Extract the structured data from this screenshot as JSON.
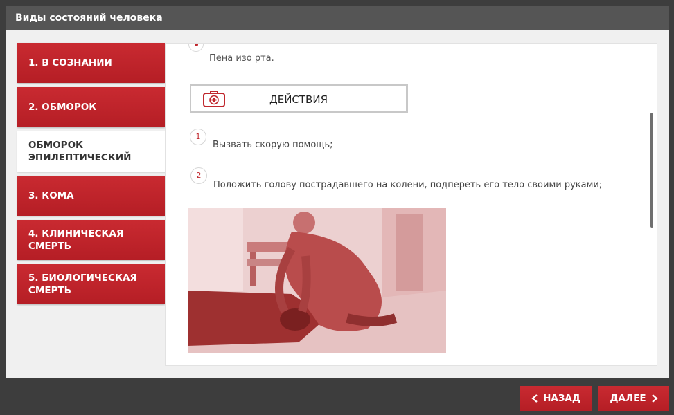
{
  "window": {
    "title": "Виды состояний человека"
  },
  "tabs": [
    {
      "label": "1. В СОЗНАНИИ",
      "active": false
    },
    {
      "label": "2. ОБМОРОК",
      "active": false
    },
    {
      "label": "ОБМОРОК ЭПИЛЕПТИЧЕСКИЙ",
      "active": true
    },
    {
      "label": "3. КОМА",
      "active": false
    },
    {
      "label": "4. КЛИНИЧЕСКАЯ СМЕРТЬ",
      "active": false
    },
    {
      "label": "5. БИОЛОГИЧЕСКАЯ СМЕРТЬ",
      "active": false
    }
  ],
  "content": {
    "symptom_text": "Пена изо рта.",
    "actions_title": "ДЕЙСТВИЯ",
    "steps": [
      {
        "number": "1",
        "text": "Вызвать скорую помощь;"
      },
      {
        "number": "2",
        "text": "Положить голову пострадавшего на колени, подпереть его тело своими руками;"
      }
    ],
    "icons": {
      "actions": "first-aid-kit-icon"
    }
  },
  "nav": {
    "back_label": "НАЗАД",
    "next_label": "ДАЛЕЕ"
  },
  "colors": {
    "accent": "#c0272d",
    "titlebar": "#555555",
    "background": "#3d3d3d"
  }
}
